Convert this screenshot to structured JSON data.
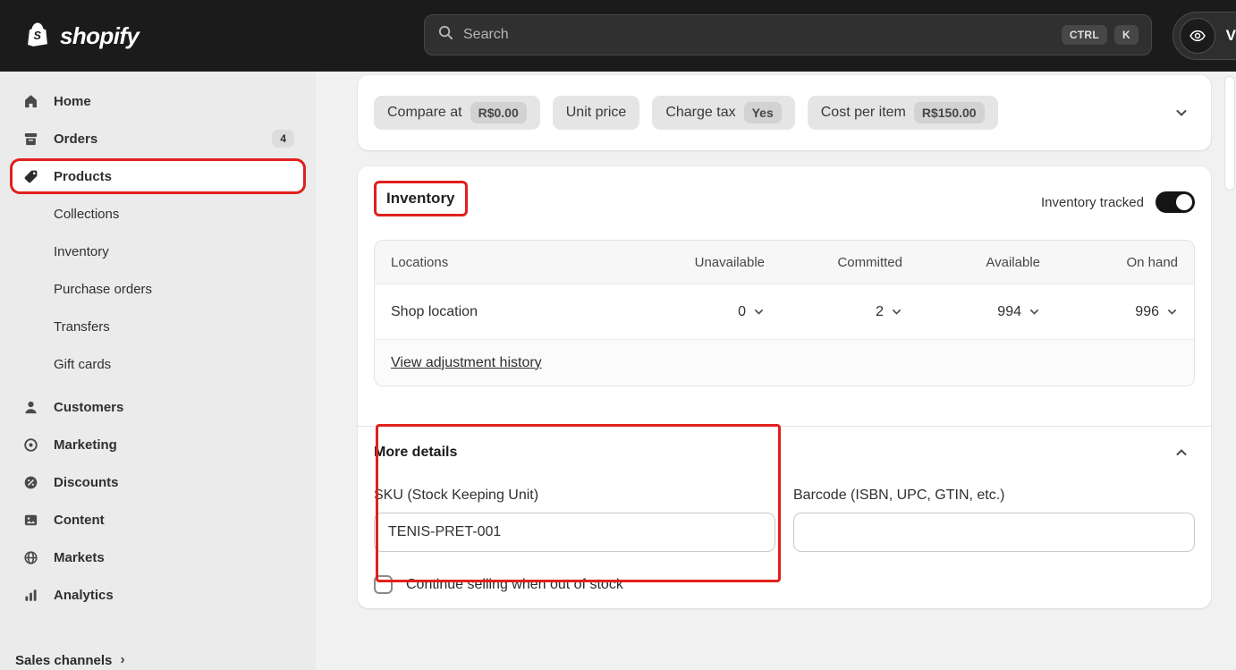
{
  "topbar": {
    "brand": "shopify",
    "search": {
      "placeholder": "Search",
      "shortcut": [
        "CTRL",
        "K"
      ]
    },
    "view_label": "View"
  },
  "sidebar": {
    "items": [
      {
        "label": "Home"
      },
      {
        "label": "Orders",
        "badge": "4"
      },
      {
        "label": "Products"
      },
      {
        "label": "Collections"
      },
      {
        "label": "Inventory"
      },
      {
        "label": "Purchase orders"
      },
      {
        "label": "Transfers"
      },
      {
        "label": "Gift cards"
      },
      {
        "label": "Customers"
      },
      {
        "label": "Marketing"
      },
      {
        "label": "Discounts"
      },
      {
        "label": "Content"
      },
      {
        "label": "Markets"
      },
      {
        "label": "Analytics"
      }
    ],
    "sales_channels_label": "Sales channels"
  },
  "pricing": {
    "pills": [
      {
        "label": "Compare at",
        "value": "R$0.00"
      },
      {
        "label": "Unit price",
        "value": ""
      },
      {
        "label": "Charge tax",
        "value": "Yes"
      },
      {
        "label": "Cost per item",
        "value": "R$150.00"
      }
    ]
  },
  "inventory": {
    "title": "Inventory",
    "tracked_label": "Inventory tracked",
    "table": {
      "headers": [
        "Locations",
        "Unavailable",
        "Committed",
        "Available",
        "On hand"
      ],
      "row": {
        "location": "Shop location",
        "unavailable": "0",
        "committed": "2",
        "available": "994",
        "on_hand": "996"
      }
    },
    "history_link": "View adjustment history",
    "more_details": {
      "title": "More details",
      "sku_label": "SKU (Stock Keeping Unit)",
      "sku_value": "TENIS-PRET-001",
      "barcode_label": "Barcode (ISBN, UPC, GTIN, etc.)",
      "barcode_value": "",
      "continue_selling_label": "Continue selling when out of stock"
    }
  },
  "colors": {
    "annotation_red": "#e0201c",
    "topbar_bg": "#1b1b1b",
    "sidebar_bg": "#ebebeb",
    "toggle_on": "#141414"
  }
}
